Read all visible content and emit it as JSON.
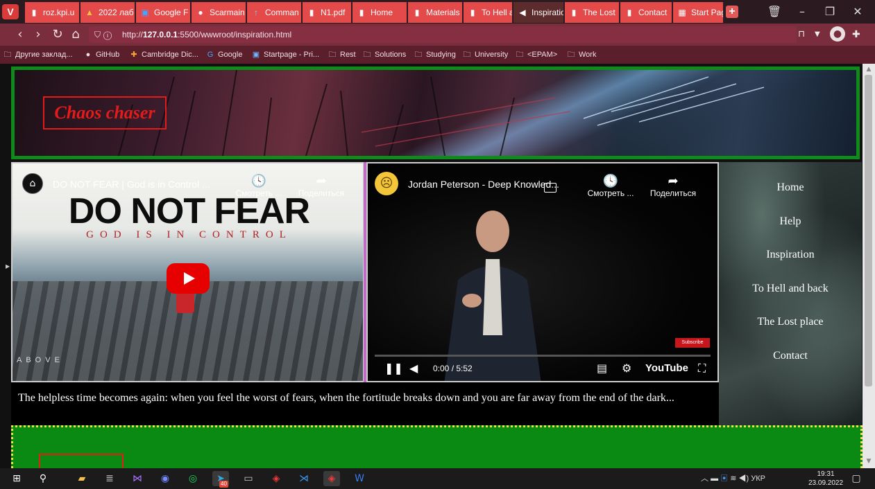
{
  "browser": {
    "tabs": [
      {
        "label": "roz.kpi.u",
        "icon": "page-icon"
      },
      {
        "label": "2022 лаб",
        "icon": "drive-icon"
      },
      {
        "label": "Google F",
        "icon": "translate-icon"
      },
      {
        "label": "Scarmain",
        "icon": "github-icon"
      },
      {
        "label": "Comman",
        "icon": "pin-icon"
      },
      {
        "label": "N1.pdf",
        "icon": "page-icon"
      },
      {
        "label": "Home",
        "icon": "page-icon"
      },
      {
        "label": "Materials",
        "icon": "page-icon"
      },
      {
        "label": "To Hell a",
        "icon": "page-icon"
      },
      {
        "label": "Inspiratio",
        "icon": "speaker-icon"
      },
      {
        "label": "The Lost",
        "icon": "page-icon"
      },
      {
        "label": "Contact",
        "icon": "page-icon"
      },
      {
        "label": "Start Pag",
        "icon": "grid-icon"
      }
    ],
    "url_prefix": "http://",
    "url_host": "127.0.0.1",
    "url_rest": ":5500/wwwroot/inspiration.html",
    "bookmarks": [
      {
        "label": "Другие заклад...",
        "icon": "folder-icon"
      },
      {
        "label": "GitHub",
        "icon": "github-icon"
      },
      {
        "label": "Cambridge Dic...",
        "icon": "cambridge-icon"
      },
      {
        "label": "Google",
        "icon": "google-icon"
      },
      {
        "label": "Startpage - Pri...",
        "icon": "startpage-icon"
      },
      {
        "label": "Rest",
        "icon": "folder-icon"
      },
      {
        "label": "Solutions",
        "icon": "folder-icon"
      },
      {
        "label": "Studying",
        "icon": "folder-icon"
      },
      {
        "label": "University",
        "icon": "folder-icon"
      },
      {
        "label": "<EPAM>",
        "icon": "folder-icon"
      },
      {
        "label": "Work",
        "icon": "folder-icon"
      }
    ]
  },
  "page": {
    "logo": "Chaos chaser",
    "nav": [
      "Home",
      "Help",
      "Inspiration",
      "To Hell and back",
      "The Lost place",
      "Contact"
    ],
    "video1": {
      "title": "DO NOT FEAR | God is in Control ...",
      "watch_later": "Смотреть ...",
      "share": "Поделиться",
      "big_text": "DO NOT FEAR",
      "sub_text": "GOD IS IN CONTROL",
      "brand": "ABOVE"
    },
    "video2": {
      "title": "Jordan Peterson - Deep Knowled...",
      "watch_later": "Смотреть ...",
      "share": "Поделиться",
      "time": "0:00 / 5:52",
      "youtube": "YouTube",
      "subscribe": "Subscribe"
    },
    "caption": "The helpless time becomes again: when you feel the worst of fears, when the fortitude breaks down and you are far away from the end of the dark..."
  },
  "taskbar": {
    "lang": "УКР",
    "time": "19:31",
    "date": "23.09.2022",
    "badge": "40"
  }
}
